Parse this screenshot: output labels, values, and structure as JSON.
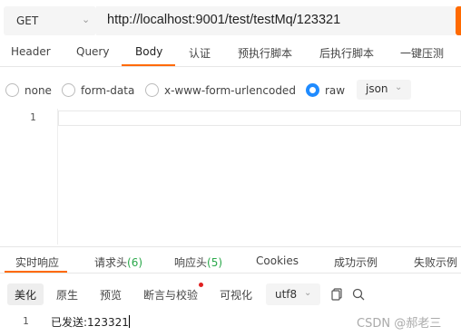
{
  "request": {
    "method": "GET",
    "url": "http://localhost:9001/test/testMq/123321"
  },
  "request_tabs": [
    "Header",
    "Query",
    "Body",
    "认证",
    "预执行脚本",
    "后执行脚本",
    "一键压测"
  ],
  "active_request_tab": "Body",
  "body_types": [
    "none",
    "form-data",
    "x-www-form-urlencoded",
    "raw"
  ],
  "selected_body_type": "raw",
  "raw_format": "json",
  "editor": {
    "line_numbers": [
      "1"
    ]
  },
  "response_tabs": {
    "realtime": "实时响应",
    "req_headers": "请求头",
    "req_headers_count": "(6)",
    "resp_headers": "响应头",
    "resp_headers_count": "(5)",
    "cookies": "Cookies",
    "success_example": "成功示例",
    "fail_example": "失败示例"
  },
  "response_views": [
    "美化",
    "原生",
    "预览",
    "断言与校验",
    "可视化"
  ],
  "active_response_view": "美化",
  "encoding": "utf8",
  "response_body": {
    "line_number": "1",
    "text": "已发送:123321"
  },
  "watermark": "CSDN @郝老三",
  "colors": {
    "accent": "#ff6a00",
    "radio_selected": "#1f8bff",
    "count_green": "#2aa84a",
    "assert_dot": "#e02020"
  },
  "icons": {
    "method_dropdown": "chevron-down-icon",
    "format_dropdown": "chevron-down-icon",
    "copy": "copy-icon",
    "search": "search-icon"
  }
}
